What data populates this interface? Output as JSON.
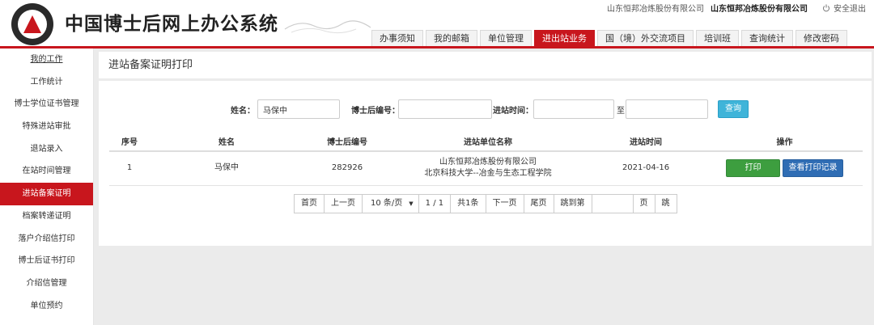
{
  "header": {
    "title": "中国博士后网上办公系统",
    "company_prefix": "山东恒邦冶炼股份有限公司",
    "company_bold": "山东恒邦冶炼股份有限公司",
    "logout": "安全退出"
  },
  "nav": [
    {
      "label": "办事须知"
    },
    {
      "label": "我的邮箱"
    },
    {
      "label": "单位管理"
    },
    {
      "label": "进出站业务"
    },
    {
      "label": "国（境）外交流项目"
    },
    {
      "label": "培训班"
    },
    {
      "label": "查询统计"
    },
    {
      "label": "修改密码"
    }
  ],
  "nav_active": "进出站业务",
  "sidebar": {
    "items": [
      {
        "label": "我的工作"
      },
      {
        "label": "工作统计"
      },
      {
        "label": "博士学位证书管理"
      },
      {
        "label": "特殊进站审批"
      },
      {
        "label": "退站录入"
      },
      {
        "label": "在站时间管理"
      },
      {
        "label": "进站备案证明"
      },
      {
        "label": "档案转递证明"
      },
      {
        "label": "落户介绍信打印"
      },
      {
        "label": "博士后证书打印"
      },
      {
        "label": "介绍信管理"
      },
      {
        "label": "单位预约"
      }
    ],
    "active": "进站备案证明"
  },
  "page": {
    "title": "进站备案证明打印"
  },
  "search": {
    "name_label": "姓名：",
    "name_value": "马保中",
    "id_label": "博士后编号：",
    "id_value": "",
    "time_label": "进站时间：",
    "time_from": "",
    "to_label": "至",
    "time_to": "",
    "query_label": "查询"
  },
  "table": {
    "headers": [
      "序号",
      "姓名",
      "博士后编号",
      "进站单位名称",
      "进站时间",
      "操作"
    ],
    "rows": [
      {
        "index": "1",
        "name": "马保中",
        "id": "282926",
        "unit_line1": "山东恒邦冶炼股份有限公司",
        "unit_line2": "北京科技大学--冶金与生态工程学院",
        "date": "2021-04-16",
        "print_label": "打印",
        "record_label": "查看打印记录"
      }
    ]
  },
  "pager": {
    "first": "首页",
    "prev": "上一页",
    "page_size": "10 条/页",
    "page_info": "1 / 1",
    "total": "共1条",
    "next": "下一页",
    "last": "尾页",
    "jump_to": "跳到第",
    "jump_value": "",
    "page_unit": "页",
    "go": "跳"
  },
  "colors": {
    "brand_red": "#c8161d",
    "query_blue": "#3fb4d9",
    "print_green": "#3d9e3f",
    "record_blue": "#2f6db4"
  },
  "icons": [
    "logo-icon",
    "power-icon",
    "chevron-down-icon"
  ]
}
